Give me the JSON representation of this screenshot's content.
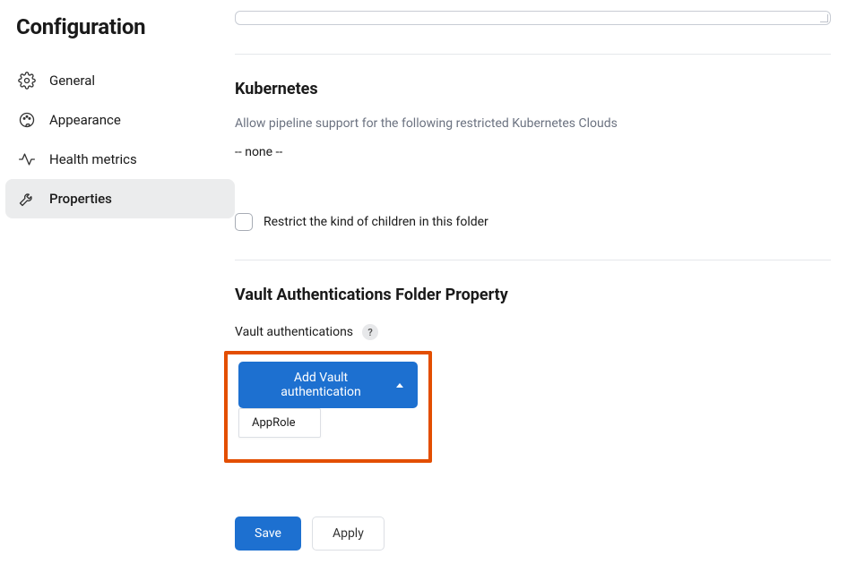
{
  "page": {
    "title": "Configuration"
  },
  "sidebar": {
    "items": [
      {
        "label": "General"
      },
      {
        "label": "Appearance"
      },
      {
        "label": "Health metrics"
      },
      {
        "label": "Properties"
      }
    ],
    "active_index": 3
  },
  "kubernetes": {
    "title": "Kubernetes",
    "description": "Allow pipeline support for the following restricted Kubernetes Clouds",
    "empty_text": "-- none --"
  },
  "restrict_children": {
    "label": "Restrict the kind of children in this folder",
    "checked": false
  },
  "vault_section": {
    "title": "Vault Authentications Folder Property",
    "field_label": "Vault authentications",
    "help_symbol": "?",
    "add_button_label": "Add Vault authentication",
    "dropdown": {
      "open": true,
      "items": [
        {
          "label": "AppRole"
        }
      ]
    }
  },
  "footer": {
    "save_label": "Save",
    "apply_label": "Apply"
  }
}
